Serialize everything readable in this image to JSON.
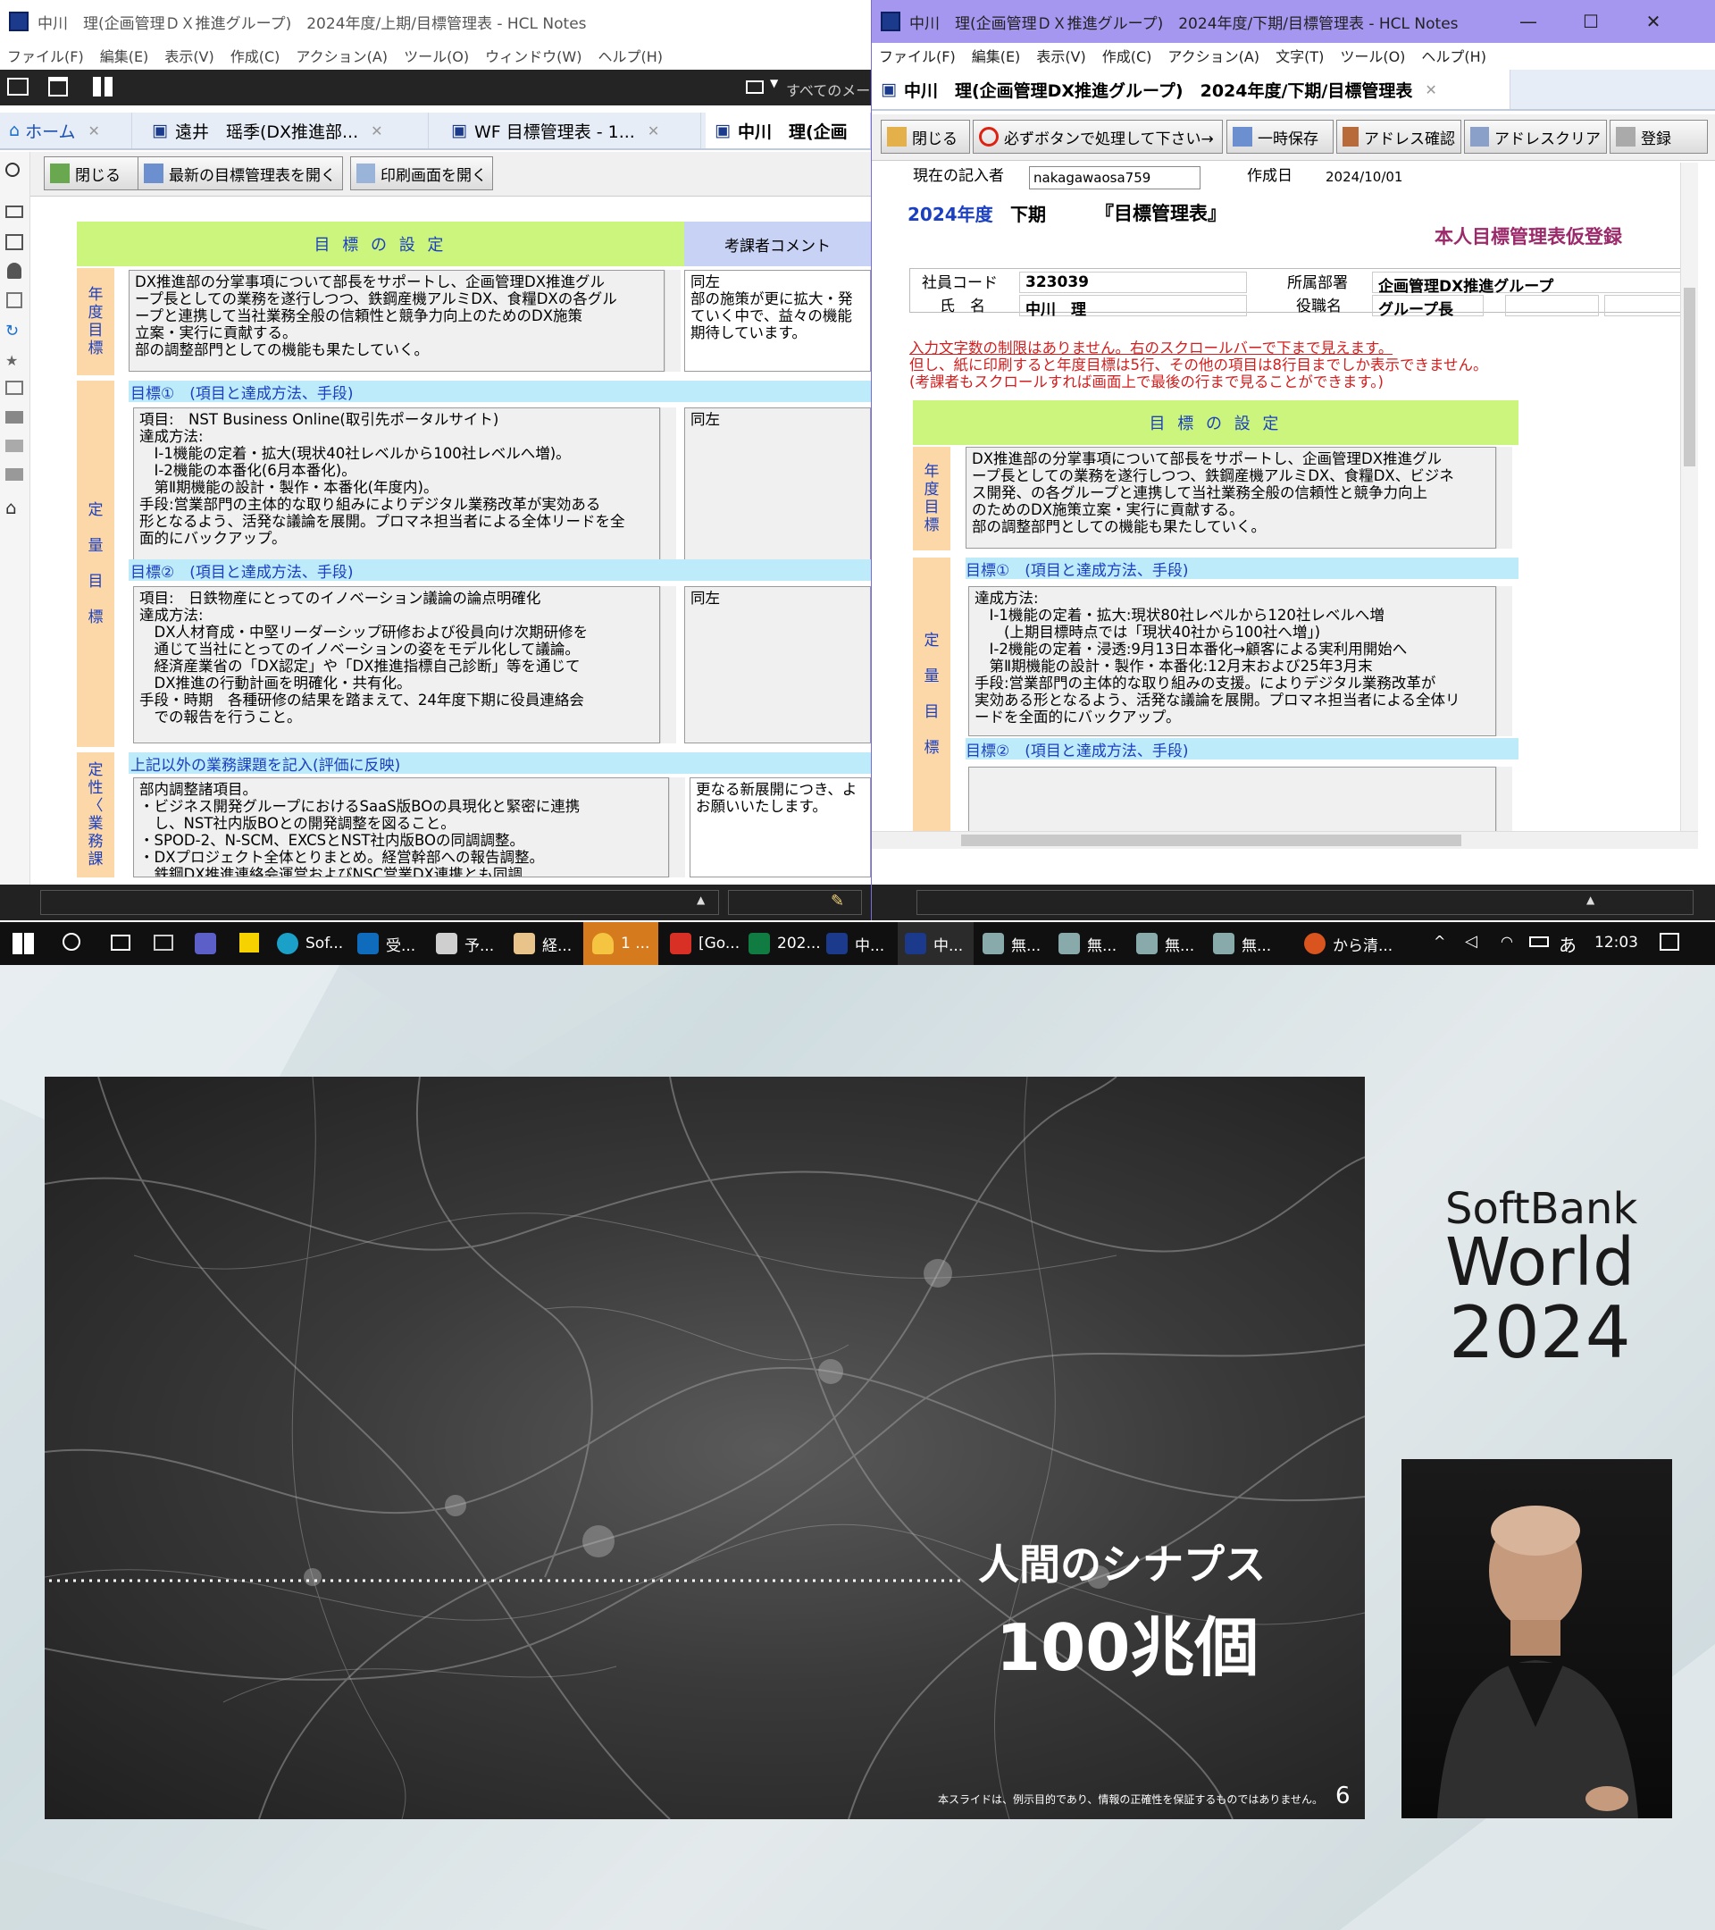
{
  "left_window": {
    "title": "中川　理(企画管理ＤＸ推進グループ)　2024年度/上期/目標管理表 - HCL Notes",
    "menu": [
      "ファイル(F)",
      "編集(E)",
      "表示(V)",
      "作成(C)",
      "アクション(A)",
      "ツール(O)",
      "ウィンドウ(W)",
      "ヘルプ(H)"
    ],
    "search_placeholder": "すべてのメール",
    "tabs": [
      {
        "label": "ホーム"
      },
      {
        "label": "遠井　瑶季(DX推進部..."
      },
      {
        "label": "WF 目標管理表 - 1..."
      },
      {
        "label": "中川　理(企画"
      }
    ],
    "actions": [
      "閉じる",
      "最新の目標管理表を開く",
      "印刷画面を開く"
    ],
    "header_setting": "目 標 の 設 定",
    "header_comment": "考課者コメント",
    "label_annual": "年\n度\n目\n標",
    "annual_text": "DX推進部の分掌事項について部長をサポートし、企画管理DX推進グル\nープ長としての業務を遂行しつつ、鉄鋼産機アルミDX、食糧DXの各グル\nープと連携して当社業務全般の信頼性と競争力向上のためのDX施策\n立案・実行に貢献する。\n部の調整部門としての機能も果たしていく。",
    "annual_comment": "同左\n部の施策が更に拡大・発\nていく中で、益々の機能\n期待しています。",
    "label_quant": "定\n\n量\n\n目\n\n標",
    "goal1_header": "目標①　(項目と達成方法、手段)",
    "goal1_text": "項目:　NST Business Online(取引先ポータルサイト)\n達成方法:\n　Ⅰ-1機能の定着・拡大(現状40社レベルから100社レベルへ増)。\n　Ⅰ-2機能の本番化(6月本番化)。\n　第Ⅱ期機能の設計・製作・本番化(年度内)。\n手段:営業部門の主体的な取り組みによりデジタル業務改革が実効ある\n形となるよう、活発な議論を展開。プロマネ担当者による全体リードを全\n面的にバックアップ。",
    "goal1_comment": "同左",
    "goal2_header": "目標②　(項目と達成方法、手段)",
    "goal2_text": "項目:　日鉄物産にとってのイノベーション議論の論点明確化\n達成方法:\n　DX人材育成・中堅リーダーシップ研修および役員向け次期研修を\n　通じて当社にとってのイノベーションの姿をモデル化して議論。\n　経済産業省の「DX認定」や「DX推進指標自己診断」等を通じて\n　DX推進の行動計画を明確化・共有化。\n手段・時期　各種研修の結果を踏まえて、24年度下期に役員連絡会\n　での報告を行うこと。",
    "goal2_comment": "同左",
    "other_header": "上記以外の業務課題を記入(評価に反映)",
    "label_qual": "定\n性\n〈\n業\n務\n課",
    "other_text": "部内調整諸項目。\n・ビジネス開発グループにおけるSaaS版BOの具現化と緊密に連携\n　し、NST社内版BOとの開発調整を図ること。\n・SPOD-2、N-SCM、EXCSとNST社内版BOの同調調整。\n・DXプロジェクト全体とりまとめ。経営幹部への報告調整。\n　鉄鋼DX推進連絡会運営およびNSC営業DX連携とも同調",
    "other_comment": "更なる新展開につき、よ\nお願いいたします。"
  },
  "right_window": {
    "title": "中川　理(企画管理ＤＸ推進グループ)　2024年度/下期/目標管理表 - HCL Notes",
    "menu": [
      "ファイル(F)",
      "編集(E)",
      "表示(V)",
      "作成(C)",
      "アクション(A)",
      "文字(T)",
      "ツール(O)",
      "ヘルプ(H)"
    ],
    "tab": "中川　理(企画管理DX推進グループ)　2024年度/下期/目標管理表",
    "actions": [
      "閉じる",
      "必ずボタンで処理して下さい→",
      "一時保存",
      "アドレス確認",
      "アドレスクリア",
      "登録"
    ],
    "writer_label": "現在の記入者",
    "writer_value": "nakagawaosa759",
    "created_label": "作成日",
    "created_value": "2024/10/01",
    "doc_year": "2024年度",
    "doc_half": "下期",
    "doc_title": "『目標管理表』",
    "doc_status": "本人目標管理表仮登録",
    "emp_code_label": "社員コード",
    "emp_code": "323039",
    "dept_label": "所属部署",
    "dept": "企画管理DX推進グループ",
    "name_label": "氏　名",
    "name": "中川　理",
    "role_label": "役職名",
    "role": "グループ長",
    "notice1": "入力文字数の制限はありません。右のスクロールバーで下まで見えます。",
    "notice2": "但し、紙に印刷すると年度目標は5行、その他の項目は8行目までしか表示できません。",
    "notice3": "(考課者もスクロールすれば画面上で最後の行まで見ることができます。)",
    "header_setting": "目 標 の 設 定",
    "label_annual": "年\n度\n目\n標",
    "annual_text": "DX推進部の分掌事項について部長をサポートし、企画管理DX推進グル\nープ長としての業務を遂行しつつ、鉄鋼産機アルミDX、食糧DX、ビジネ\nス開発、の各グループと連携して当社業務全般の信頼性と競争力向上\nのためのDX施策立案・実行に貢献する。\n部の調整部門としての機能も果たしていく。",
    "label_quant": "定\n\n量\n\n目\n\n標",
    "goal1_header": "目標①　(項目と達成方法、手段)",
    "goal1_text": "達成方法:\n　Ⅰ-1機能の定着・拡大:現状80社レベルから120社レベルへ増\n　　(上期目標時点では「現状40社から100社へ増」)\n　Ⅰ-2機能の定着・浸透:9月13日本番化→顧客による実利用開始へ\n　第Ⅱ期機能の設計・製作・本番化:12月末および25年3月末\n手段:営業部門の主体的な取り組みの支援。によりデジタル業務改革が\n実効ある形となるよう、活発な議論を展開。プロマネ担当者による全体リ\nードを全面的にバックアップ。",
    "goal2_header": "目標②　(項目と達成方法、手段)"
  },
  "taskbar": {
    "items": [
      "Sof...",
      "受...",
      "予...",
      "経...",
      "1 ...",
      "[Go...",
      "202...",
      "中...",
      "中...",
      "無...",
      "無...",
      "無...",
      "無..."
    ],
    "notify": "から清...",
    "ime": "あ",
    "time": "12:03"
  },
  "slide": {
    "caption1": "人間のシナプス",
    "caption2": "100兆個",
    "disclaimer": "本スライドは、例示目的であり、情報の正確性を保証するものではありません。",
    "page": "6",
    "brand1": "SoftBank",
    "brand2": "World",
    "brand3": "2024"
  }
}
